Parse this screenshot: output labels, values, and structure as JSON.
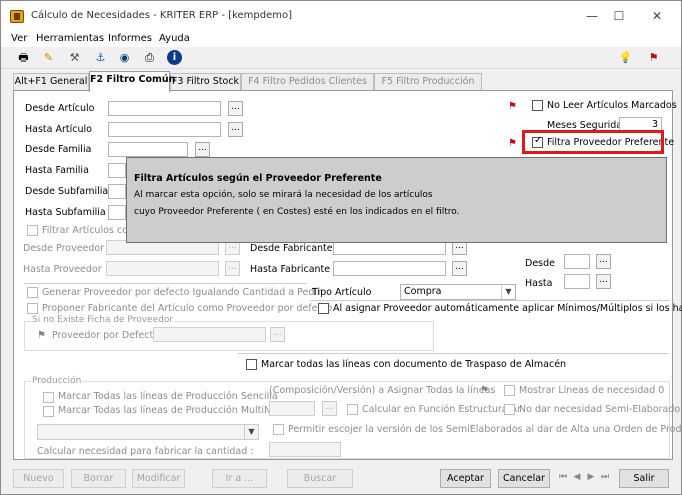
{
  "window": {
    "title": "Cálculo de Necesidades - KRITER ERP - [kempdemo]",
    "minimize": "—",
    "maximize": "☐",
    "close": "✕"
  },
  "menu": [
    "Ver",
    "Herramientas",
    "Informes",
    "Ayuda"
  ],
  "toolbar_icons": [
    "printer-icon",
    "pencil-icon",
    "hammer-icon",
    "hook-icon",
    "eye-icon",
    "print-icon",
    "info-icon"
  ],
  "toolbar_right_icons": [
    "lightbulb-icon",
    "flag-icon"
  ],
  "tabs": [
    "Alt+F1 General",
    "F2 Filtro Común",
    "F3 Filtro Stock",
    "F4 Filtro Pedidos Clientes",
    "F5 Filtro Producción"
  ],
  "dots": "...",
  "filters": {
    "desde_articulo": "Desde Artículo",
    "hasta_articulo": "Hasta Artículo",
    "desde_familia": "Desde Familia",
    "hasta_familia": "Hasta Familia",
    "desde_subfamilia": "Desde Subfamilia",
    "hasta_subfamilia": "Hasta Subfamilia",
    "filtrar_articulos": "Filtrar Artículos con P",
    "desde_proveedor": "Desde Proveedor",
    "hasta_proveedor": "Hasta Proveedor",
    "desde_fabricante": "Desde Fabricante",
    "hasta_fabricante": "Hasta Fabricante",
    "desde": "Desde",
    "hasta": "Hasta"
  },
  "right": {
    "no_leer": "No Leer Artículos Marcados",
    "meses_seguridad": "Meses Seguridad",
    "meses_value": "3",
    "filtra_proveedor": "Filtra Proveedor Preferente"
  },
  "tooltip": {
    "title": "Filtra Artículos según el Proveedor Preferente",
    "line1": "Al marcar esta opción, solo se mirará la necesidad de los artículos",
    "line2": "cuyo Proveedor Preferente ( en Costes) esté en los indicados en el filtro."
  },
  "options": {
    "generar_proveedor": "Generar Proveedor por defecto Igualando Cantidad a Pedir",
    "proponer_fabricante": "Proponer Fabricante del Artículo como Proveedor por defecto",
    "tipo_articulo": "Tipo Artículo",
    "tipo_value": "Compra",
    "asignar_proveedor": "Al asignar Proveedor automáticamente aplicar Mínimos/Múltiplos si los hay",
    "si_no_existe": "Si no Existe Ficha de Proveedor",
    "proveedor_defecto": "Proveedor por Defecto",
    "marcar_traspaso": "Marcar todas las líneas con documento de Traspaso de Almacén"
  },
  "produccion": {
    "title": "Producción",
    "marcar_sencilla": "Marcar Todas las líneas de Producción Sencilla",
    "marcar_multinivel": "Marcar Todas las líneas de Producción MultiNivel",
    "composicion": "(Composición/Versión) a Asignar Todas la líneas",
    "calcular_estructura": "Calcular en Función Estructura Ar",
    "mostrar_lineas": "Mostrar Líneas de necesidad 0",
    "no_dar": "No dar necesidad Semi-Elaborado",
    "permitir": "Permitir escojer la versión de los SemiElaborados al dar de Alta una Orden de Producción.",
    "calcular_necesidad": "Calcular necesidad para fabricar la cantidad :"
  },
  "buttons": {
    "nuevo": "Nuevo",
    "borrar": "Borrar",
    "modificar": "Modificar",
    "ir_a": "Ir a ...",
    "buscar": "Buscar",
    "aceptar": "Aceptar",
    "cancelar": "Cancelar",
    "salir": "Salir"
  }
}
